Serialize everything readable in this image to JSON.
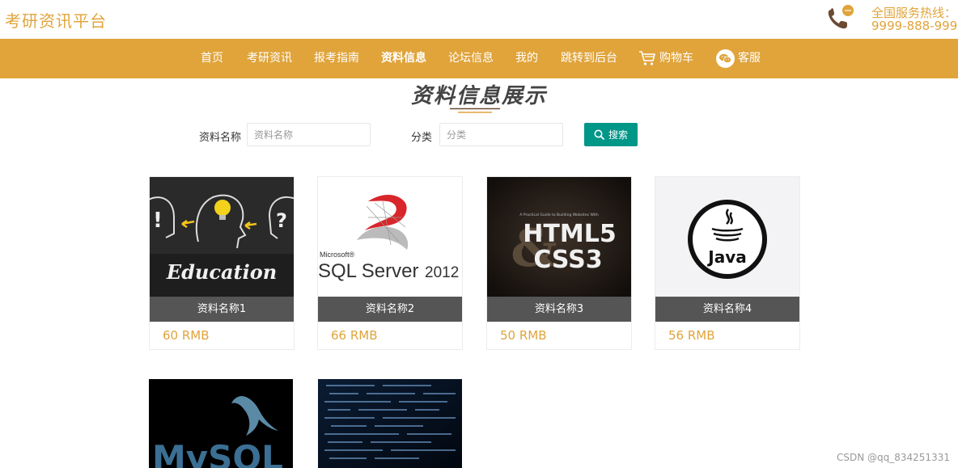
{
  "header": {
    "logo": "考研资讯平台",
    "hotline_label": "全国服务热线：",
    "hotline_number": "9999-888-999",
    "hotline_icon": "phone-icon"
  },
  "nav": {
    "items": [
      {
        "label": "首页"
      },
      {
        "label": "考研资讯"
      },
      {
        "label": "报考指南"
      },
      {
        "label": "资料信息",
        "active": true
      },
      {
        "label": "论坛信息"
      },
      {
        "label": "我的"
      },
      {
        "label": "跳转到后台"
      },
      {
        "label": "购物车",
        "icon": "cart-icon"
      },
      {
        "label": "客服",
        "icon": "wechat-icon"
      }
    ]
  },
  "page": {
    "title": "资料信息展示"
  },
  "search": {
    "name_label": "资料名称",
    "name_placeholder": "资料名称",
    "category_label": "分类",
    "category_placeholder": "分类",
    "button_label": "搜索"
  },
  "products": [
    {
      "name": "资料名称1",
      "price": "60 RMB",
      "image": "education-image"
    },
    {
      "name": "资料名称2",
      "price": "66 RMB",
      "image": "sql-server-2012-image"
    },
    {
      "name": "资料名称3",
      "price": "50 RMB",
      "image": "html5-css3-image"
    },
    {
      "name": "资料名称4",
      "price": "56 RMB",
      "image": "java-logo-image"
    },
    {
      "image": "mysql-logo-image"
    },
    {
      "image": "code-screen-image"
    }
  ],
  "image_text": {
    "education": "Education",
    "sql_vendor": "Microsoft®",
    "sql_product": "SQL Server",
    "sql_version": "2012",
    "html_tagline": "A Practical Guide to Building Websites With",
    "html_line1": "HTML5",
    "html_line2": "CSS3",
    "java": "Java",
    "mysql": "MySQL"
  },
  "watermark": "CSDN @qq_834251331",
  "colors": {
    "brand": "#e0a43b",
    "button": "#009688",
    "card_label_bg": "#555555"
  }
}
